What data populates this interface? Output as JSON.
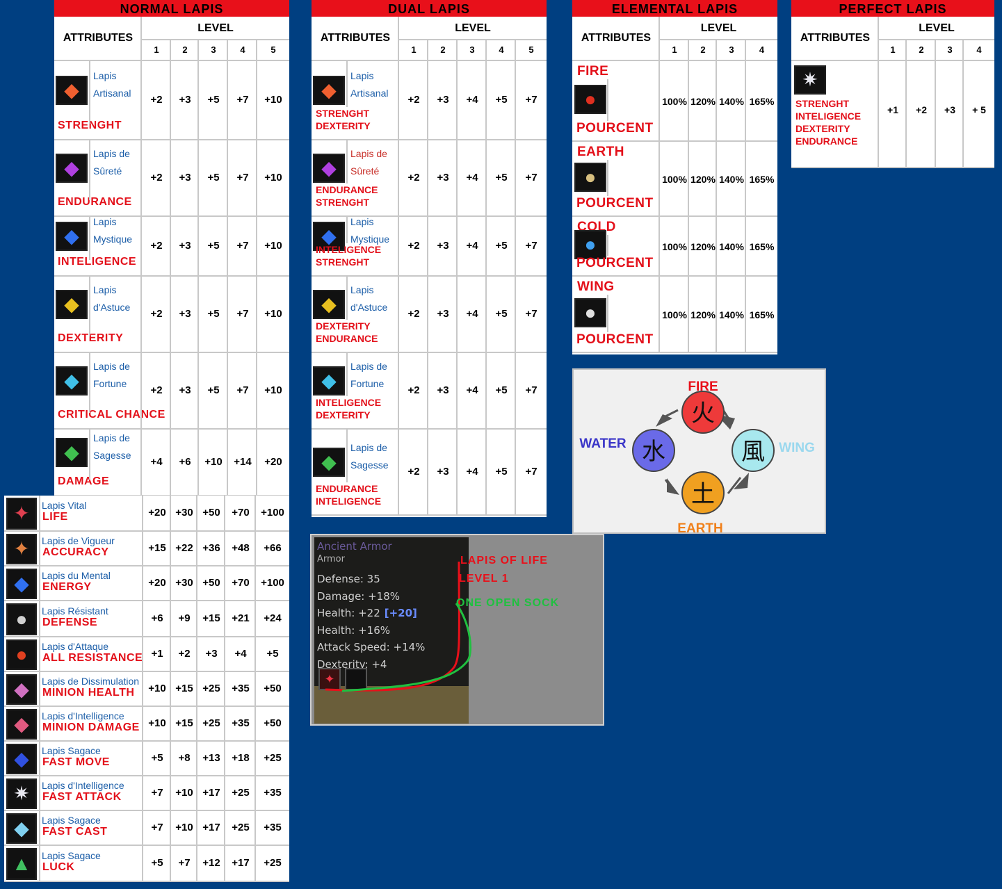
{
  "normal": {
    "title": "NORMAL LAPIS",
    "attributes_label": "ATTRIBUTES",
    "level_label": "LEVEL",
    "levels": [
      "1",
      "2",
      "3",
      "4",
      "5"
    ],
    "rows": [
      {
        "line1": "Lapis",
        "line2": "Artisanal",
        "attr": "STRENGHT",
        "values": [
          "+2",
          "+3",
          "+5",
          "+7",
          "+10"
        ],
        "gem": "orange"
      },
      {
        "line1": "Lapis de",
        "line2": "Sûreté",
        "attr": "ENDURANCE",
        "values": [
          "+2",
          "+3",
          "+5",
          "+7",
          "+10"
        ],
        "gem": "purple"
      },
      {
        "line1": "Lapis",
        "line2": "Mystique",
        "attr": "INTELIGENCE",
        "values": [
          "+2",
          "+3",
          "+5",
          "+7",
          "+10"
        ],
        "gem": "blue"
      },
      {
        "line1": "Lapis",
        "line2": "d'Astuce",
        "attr": "DEXTERITY",
        "values": [
          "+2",
          "+3",
          "+5",
          "+7",
          "+10"
        ],
        "gem": "yellow"
      },
      {
        "line1": "Lapis de",
        "line2": "Fortune",
        "attr": "CRITICAL CHANCE",
        "values": [
          "+2",
          "+3",
          "+5",
          "+7",
          "+10"
        ],
        "gem": "cyan"
      },
      {
        "line1": "Lapis de",
        "line2": "Sagesse",
        "attr": "DAMAGE",
        "values": [
          "+4",
          "+6",
          "+10",
          "+14",
          "+20"
        ],
        "gem": "green"
      }
    ]
  },
  "lower": {
    "rows": [
      {
        "name": "Lapis Vital",
        "attr": "LIFE",
        "values": [
          "+20",
          "+30",
          "+50",
          "+70",
          "+100"
        ],
        "gem": "red"
      },
      {
        "name": "Lapis de Vigueur",
        "attr": "ACCURACY",
        "values": [
          "+15",
          "+22",
          "+36",
          "+48",
          "+66"
        ],
        "gem": "amber"
      },
      {
        "name": "Lapis du Mental",
        "attr": "ENERGY",
        "values": [
          "+20",
          "+30",
          "+50",
          "+70",
          "+100"
        ],
        "gem": "blue"
      },
      {
        "name": "Lapis Résistant",
        "attr": "DEFENSE",
        "values": [
          "+6",
          "+9",
          "+15",
          "+21",
          "+24"
        ],
        "gem": "silver"
      },
      {
        "name": "Lapis d'Attaque",
        "attr": "ALL RESISTANCE",
        "values": [
          "+1",
          "+2",
          "+3",
          "+4",
          "+5"
        ],
        "gem": "orb"
      },
      {
        "name": "Lapis de Dissimulation",
        "attr": "MINION HEALTH",
        "values": [
          "+10",
          "+15",
          "+25",
          "+35",
          "+50"
        ],
        "gem": "pink"
      },
      {
        "name": "Lapis d'Intelligence",
        "attr": "MINION DAMAGE",
        "values": [
          "+10",
          "+15",
          "+25",
          "+35",
          "+50"
        ],
        "gem": "rose"
      },
      {
        "name": "Lapis Sagace",
        "attr": "FAST MOVE",
        "values": [
          "+5",
          "+8",
          "+13",
          "+18",
          "+25"
        ],
        "gem": "sapphire"
      },
      {
        "name": "Lapis d'Intelligence",
        "attr": "FAST ATTACK",
        "values": [
          "+7",
          "+10",
          "+17",
          "+25",
          "+35"
        ],
        "gem": "white"
      },
      {
        "name": "Lapis Sagace",
        "attr": "FAST CAST",
        "values": [
          "+7",
          "+10",
          "+17",
          "+25",
          "+35"
        ],
        "gem": "ice"
      },
      {
        "name": "Lapis Sagace",
        "attr": "LUCK",
        "values": [
          "+5",
          "+7",
          "+12",
          "+17",
          "+25"
        ],
        "gem": "emerald"
      }
    ]
  },
  "dual": {
    "title": "DUAL LAPIS",
    "attributes_label": "ATTRIBUTES",
    "level_label": "LEVEL",
    "levels": [
      "1",
      "2",
      "3",
      "4",
      "5"
    ],
    "rows": [
      {
        "line1": "Lapis",
        "line2": "Artisanal",
        "attr1": "STRENGHT",
        "attr2": "DEXTERITY",
        "values": [
          "+2",
          "+3",
          "+4",
          "+5",
          "+7"
        ],
        "gem": "orange"
      },
      {
        "line1": "Lapis de",
        "line2": "Sûreté",
        "attr1": "ENDURANCE",
        "attr2": "STRENGHT",
        "values": [
          "+2",
          "+3",
          "+4",
          "+5",
          "+7"
        ],
        "gem": "purple"
      },
      {
        "line1": "Lapis",
        "line2": "Mystique",
        "attr1": "INTELIGENCE",
        "attr2": "STRENGHT",
        "values": [
          "+2",
          "+3",
          "+4",
          "+5",
          "+7"
        ],
        "gem": "blue"
      },
      {
        "line1": "Lapis",
        "line2": "d'Astuce",
        "attr1": "DEXTERITY",
        "attr2": "ENDURANCE",
        "values": [
          "+2",
          "+3",
          "+4",
          "+5",
          "+7"
        ],
        "gem": "yellow"
      },
      {
        "line1": "Lapis de",
        "line2": "Fortune",
        "attr1": "INTELIGENCE",
        "attr2": "DEXTERITY",
        "values": [
          "+2",
          "+3",
          "+4",
          "+5",
          "+7"
        ],
        "gem": "cyan"
      },
      {
        "line1": "Lapis de",
        "line2": "Sagesse",
        "attr1": "ENDURANCE",
        "attr2": "INTELIGENCE",
        "values": [
          "+2",
          "+3",
          "+4",
          "+5",
          "+7"
        ],
        "gem": "green"
      }
    ]
  },
  "elemental": {
    "title": "ELEMENTAL LAPIS",
    "attributes_label": "ATTRIBUTES",
    "level_label": "LEVEL",
    "levels": [
      "1",
      "2",
      "3",
      "4"
    ],
    "rows": [
      {
        "element": "FIRE",
        "attr": "POURCENT",
        "values": [
          "100%",
          "120%",
          "140%",
          "165%"
        ],
        "gem": "fire"
      },
      {
        "element": "EARTH",
        "attr": "POURCENT",
        "values": [
          "100%",
          "120%",
          "140%",
          "165%"
        ],
        "gem": "earth"
      },
      {
        "element": "COLD",
        "attr": "POURCENT",
        "values": [
          "100%",
          "120%",
          "140%",
          "165%"
        ],
        "gem": "cold"
      },
      {
        "element": "WING",
        "attr": "POURCENT",
        "values": [
          "100%",
          "120%",
          "140%",
          "165%"
        ],
        "gem": "wing"
      }
    ]
  },
  "perfect": {
    "title": "PERFECT LAPIS",
    "attributes_label": "ATTRIBUTES",
    "level_label": "LEVEL",
    "levels": [
      "1",
      "2",
      "3",
      "4"
    ],
    "attrs": [
      "STRENGHT",
      "INTELIGENCE",
      "DEXTERITY",
      "ENDURANCE"
    ],
    "values": [
      "+1",
      "+2",
      "+3",
      "+ 5"
    ]
  },
  "cycle": {
    "fire": "FIRE",
    "water": "WATER",
    "wing": "WING",
    "earth": "EARTH",
    "fire_glyph": "火",
    "water_glyph": "水",
    "wing_glyph": "風",
    "earth_glyph": "土",
    "colors": {
      "fire": "#e8101a",
      "water": "#3a35c8",
      "wing": "#9ad8ee",
      "earth": "#f0801a"
    }
  },
  "tooltip": {
    "item_name": "Ancient Armor",
    "item_type": "Armor",
    "lines": [
      "Defense: 35",
      "Damage: +18%",
      "Health: +22",
      "Health: +16%",
      "Attack Speed: +14%",
      "Dexterity: +4"
    ],
    "bonus": "[+20]",
    "label_lapis": "LAPIS OF LIFE",
    "label_level": "LEVEL 1",
    "label_socket": "ONE OPEN SOCK"
  }
}
